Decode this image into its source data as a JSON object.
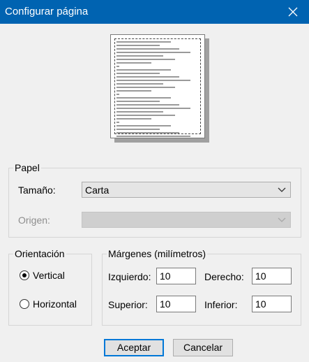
{
  "window": {
    "title": "Configurar página"
  },
  "paper": {
    "legend": "Papel",
    "size_label": "Tamaño:",
    "size_value": "Carta",
    "source_label": "Origen:",
    "source_value": ""
  },
  "orientation": {
    "legend": "Orientación",
    "portrait": "Vertical",
    "landscape": "Horizontal",
    "selected": "Vertical"
  },
  "margins": {
    "legend": "Márgenes (milímetros)",
    "left_label": "Izquierdo:",
    "left_value": "10",
    "right_label": "Derecho:",
    "right_value": "10",
    "top_label": "Superior:",
    "top_value": "10",
    "bottom_label": "Inferior:",
    "bottom_value": "10"
  },
  "buttons": {
    "ok": "Aceptar",
    "cancel": "Cancelar"
  },
  "colors": {
    "titlebar": "#0063b1",
    "accent": "#0078d7"
  },
  "icons": {
    "close": "close-icon",
    "dropdown": "chevron-down-icon"
  }
}
